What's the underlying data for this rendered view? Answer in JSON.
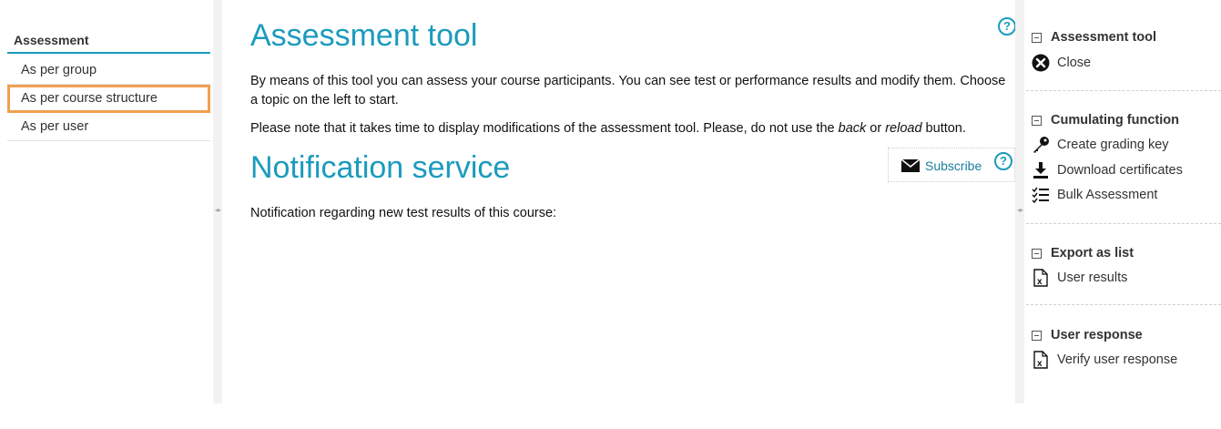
{
  "left_nav": {
    "title": "Assessment",
    "items": [
      {
        "label": "As per group"
      },
      {
        "label": "As per course structure"
      },
      {
        "label": "As per user"
      }
    ]
  },
  "main": {
    "heading1": "Assessment tool",
    "para1": "By means of this tool you can assess your course participants. You can see test or performance results and modify them. Choose a topic on the left to start.",
    "para2_a": "Please note that it takes time to display modifications of the assessment tool. Please, do not use the ",
    "para2_b": "back",
    "para2_c": " or ",
    "para2_d": "reload",
    "para2_e": " button.",
    "heading2": "Notification service",
    "subscribe_label": "Subscribe",
    "notification_text": "Notification regarding new test results of this course:",
    "help_glyph": "?"
  },
  "right_panel": {
    "sections": [
      {
        "title": "Assessment tool",
        "links": [
          {
            "label": "Close",
            "icon": "close-icon"
          }
        ]
      },
      {
        "title": "Cumulating function",
        "links": [
          {
            "label": "Create grading key",
            "icon": "key-icon"
          },
          {
            "label": "Download certificates",
            "icon": "download-icon"
          },
          {
            "label": "Bulk Assessment",
            "icon": "checklist-icon"
          }
        ]
      },
      {
        "title": "Export as list",
        "links": [
          {
            "label": "User results",
            "icon": "excel-file-icon"
          }
        ]
      },
      {
        "title": "User response",
        "links": [
          {
            "label": "Verify user response",
            "icon": "excel-file-icon"
          }
        ]
      }
    ]
  },
  "colors": {
    "accent": "#1a9bbd",
    "highlight": "#f0a050"
  }
}
